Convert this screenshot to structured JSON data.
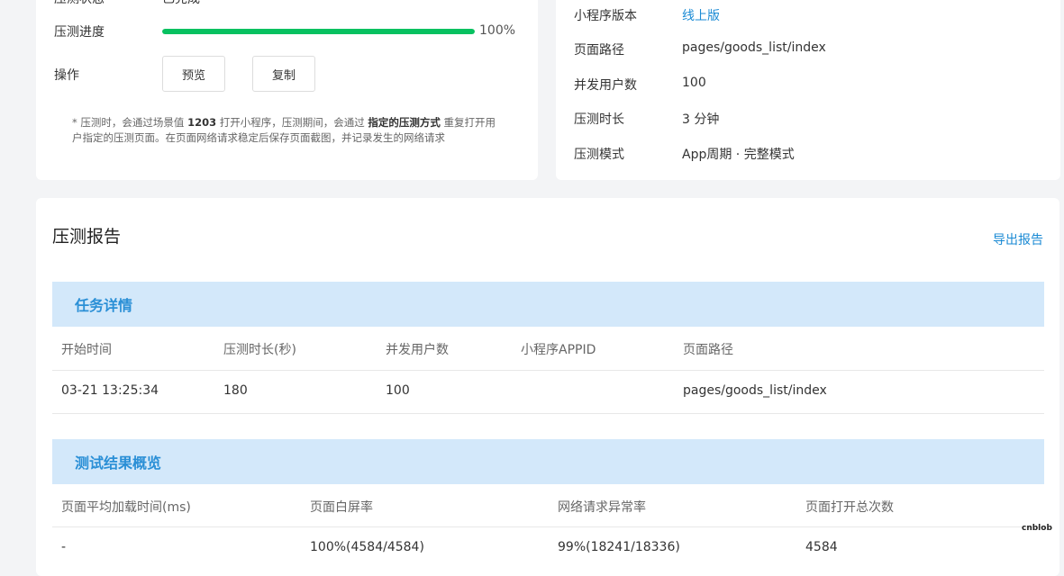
{
  "task_info": {
    "status_label": "压测状态",
    "status_value": "已完成",
    "progress_label": "压测进度",
    "progress_percent": 100,
    "progress_text": "100%",
    "actions_label": "操作",
    "preview_button": "预览",
    "copy_button": "复制",
    "note_prefix": "* 压测时，会通过场景值 ",
    "note_scene": "1203",
    "note_mid": " 打开小程序，压测期间，会通过 ",
    "note_mode": "指定的压测方式",
    "note_suffix": " 重复打开用户指定的压测页面。在页面网络请求稳定后保存页面截图，并记录发生的网络请求"
  },
  "config": {
    "version_label": "小程序版本",
    "version_value": "线上版",
    "path_label": "页面路径",
    "path_value": "pages/goods_list/index",
    "users_label": "并发用户数",
    "users_value": "100",
    "duration_label": "压测时长",
    "duration_value": "3 分钟",
    "mode_label": "压测模式",
    "mode_value": "App周期 · 完整模式"
  },
  "report": {
    "title": "压测报告",
    "export_label": "导出报告",
    "task_section": {
      "title": "任务详情",
      "headers": [
        "开始时间",
        "压测时长(秒)",
        "并发用户数",
        "小程序APPID",
        "页面路径"
      ],
      "row": [
        "03-21 13:25:34",
        "180",
        "100",
        "",
        "pages/goods_list/index"
      ]
    },
    "result_section": {
      "title": "测试结果概览",
      "headers": [
        "页面平均加载时间(ms)",
        "页面白屏率",
        "网络请求异常率",
        "页面打开总次数"
      ],
      "row": [
        "-",
        "100%(4584/4584)",
        "99%(18241/18336)",
        "4584"
      ]
    }
  },
  "watermark": "cnblob",
  "colors": {
    "accent": "#1a8ad4",
    "progress": "#07c160",
    "section_bg": "#d3e8fa",
    "section_text": "#2a8fd6"
  }
}
